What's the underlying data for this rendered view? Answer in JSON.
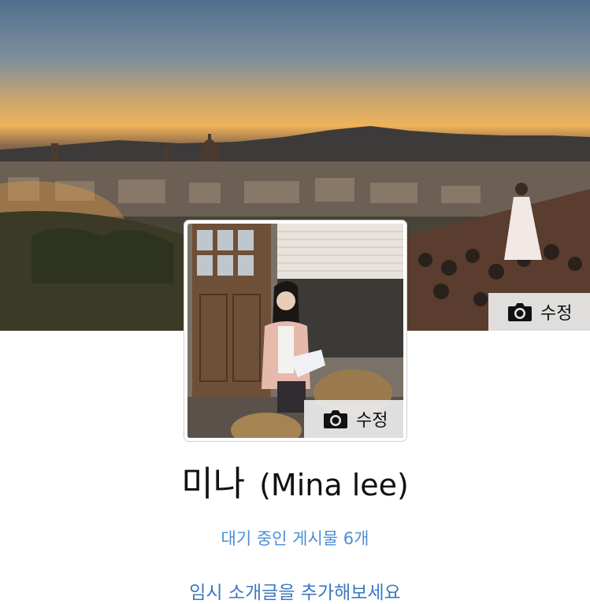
{
  "cover": {
    "edit_label": "수정",
    "icon": "camera-icon"
  },
  "profile": {
    "edit_label": "수정",
    "icon": "camera-icon",
    "name": "미나",
    "alt_name": "(Mina lee)"
  },
  "links": {
    "pending_posts": "대기 중인 게시물 6개",
    "add_intro": "임시 소개글을 추가해보세요"
  }
}
